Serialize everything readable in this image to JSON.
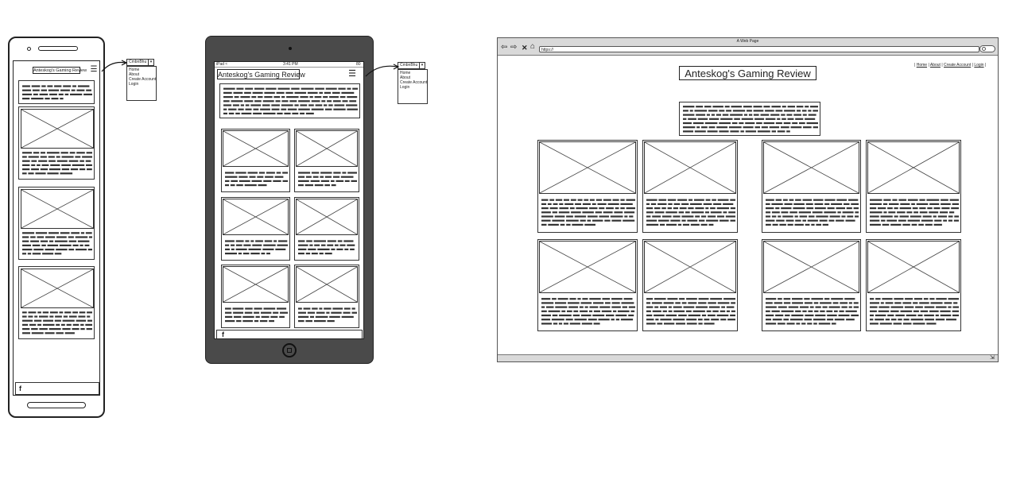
{
  "site_title": "Anteskog's Gaming Review",
  "dropdown": {
    "label": "CmbnBhu",
    "arrow": "▾",
    "items": [
      "Home",
      "About",
      "Create Account",
      "Login"
    ]
  },
  "hamburger": "☰",
  "social": {
    "facebook": "f"
  },
  "tablet_status": {
    "left": "iPad ≈",
    "time": "3:41 PM",
    "battery": "80"
  },
  "browser": {
    "window_title": "A Web Page",
    "url": "https://",
    "nav_links": [
      "Home",
      "About",
      "Create Account",
      "Login"
    ],
    "separator": "|"
  },
  "colors": {
    "frame": "#333333",
    "tablet_body": "#4a4a4a",
    "chrome": "#d9d9d9"
  }
}
